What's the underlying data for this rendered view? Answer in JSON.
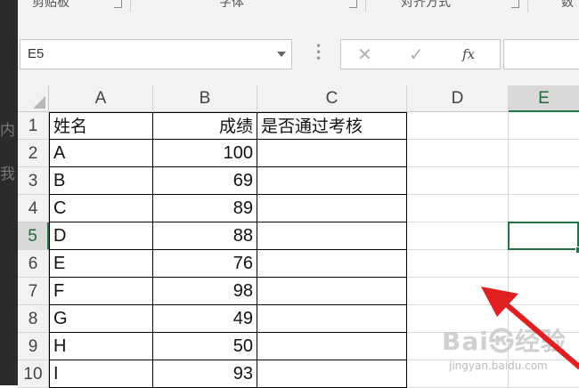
{
  "ribbon": {
    "groups": [
      {
        "label": "剪贴板"
      },
      {
        "label": "字体"
      },
      {
        "label": "对齐方式"
      },
      {
        "label": "数"
      }
    ]
  },
  "background_text": [
    "内",
    "我"
  ],
  "formula_bar": {
    "name_box": "E5",
    "cancel_glyph": "✕",
    "enter_glyph": "✓",
    "fx_label": "fx",
    "formula": ""
  },
  "sheet": {
    "columns": [
      "A",
      "B",
      "C",
      "D",
      "E"
    ],
    "active_column": "E",
    "active_row": "5",
    "rows": [
      {
        "row": "1",
        "a": "姓名",
        "b": "成绩",
        "c": "是否通过考核"
      },
      {
        "row": "2",
        "a": "A",
        "b": "100",
        "c": ""
      },
      {
        "row": "3",
        "a": "B",
        "b": "69",
        "c": ""
      },
      {
        "row": "4",
        "a": "C",
        "b": "89",
        "c": ""
      },
      {
        "row": "5",
        "a": "D",
        "b": "88",
        "c": ""
      },
      {
        "row": "6",
        "a": "E",
        "b": "76",
        "c": ""
      },
      {
        "row": "7",
        "a": "F",
        "b": "98",
        "c": ""
      },
      {
        "row": "8",
        "a": "G",
        "b": "49",
        "c": ""
      },
      {
        "row": "9",
        "a": "H",
        "b": "50",
        "c": ""
      },
      {
        "row": "10",
        "a": "I",
        "b": "93",
        "c": ""
      }
    ]
  },
  "watermark": {
    "main": "Bai㉿经验",
    "sub": "jingyan.baidu.com"
  },
  "colors": {
    "accent": "#217346",
    "annotation": "#e02020"
  }
}
